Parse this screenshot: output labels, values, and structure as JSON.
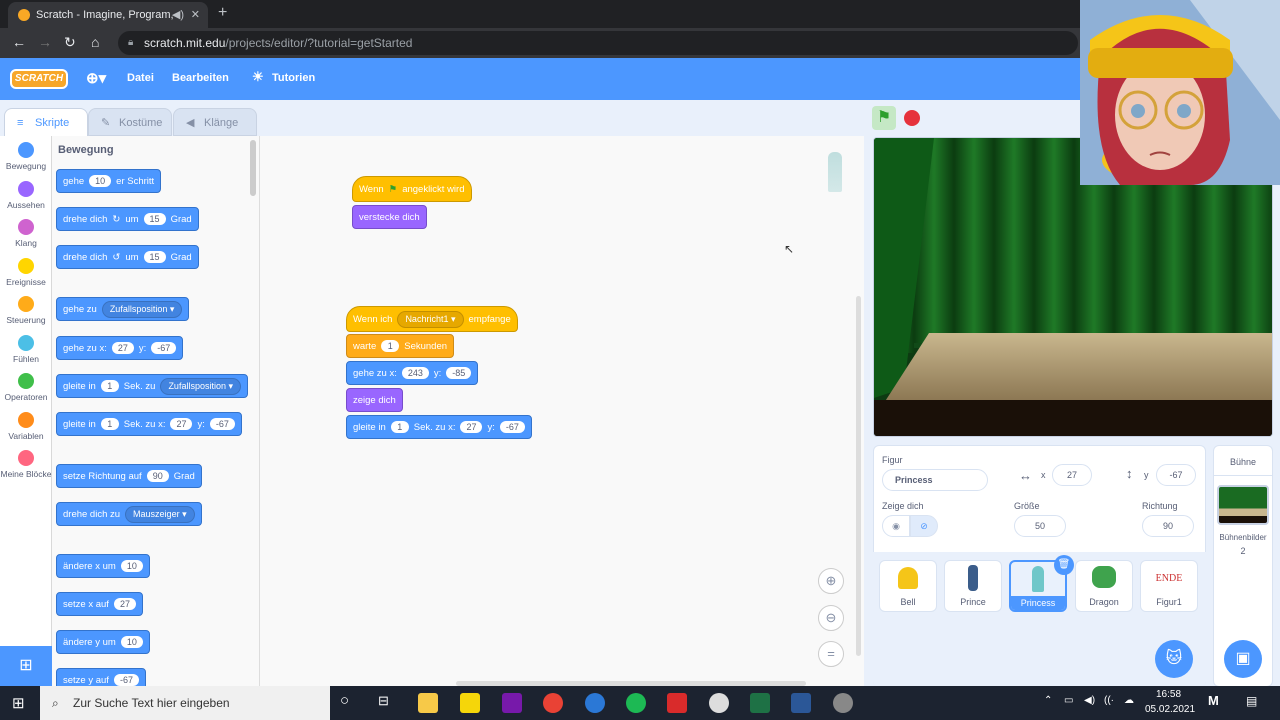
{
  "browser": {
    "tab_title": "Scratch - Imagine, Program,",
    "url_host": "scratch.mit.edu",
    "url_path": "/projects/editor/?tutorial=getStarted"
  },
  "menu": {
    "logo": "SCRATCH",
    "file": "Datei",
    "edit": "Bearbeiten",
    "tutorials": "Tutorien"
  },
  "tabs": {
    "code": "Skripte",
    "costumes": "Kostüme",
    "sounds": "Klänge"
  },
  "categories": [
    {
      "label": "Bewegung",
      "color": "#4c97ff"
    },
    {
      "label": "Aussehen",
      "color": "#9966ff"
    },
    {
      "label": "Klang",
      "color": "#cf63cf"
    },
    {
      "label": "Ereignisse",
      "color": "#ffd500"
    },
    {
      "label": "Steuerung",
      "color": "#ffab19"
    },
    {
      "label": "Fühlen",
      "color": "#4cbfe6"
    },
    {
      "label": "Operatoren",
      "color": "#40bf4a"
    },
    {
      "label": "Variablen",
      "color": "#ff8c1a"
    },
    {
      "label": "Meine Blöcke",
      "color": "#ff6680"
    }
  ],
  "palette": {
    "heading": "Bewegung",
    "b1": {
      "a": "gehe",
      "v": "10",
      "b": "er Schritt"
    },
    "b2": {
      "a": "drehe dich",
      "b": "um",
      "v": "15",
      "c": "Grad"
    },
    "b3": {
      "a": "drehe dich",
      "b": "um",
      "v": "15",
      "c": "Grad"
    },
    "b4": {
      "a": "gehe zu",
      "d": "Zufallsposition"
    },
    "b5": {
      "a": "gehe zu x:",
      "x": "27",
      "b": "y:",
      "y": "-67"
    },
    "b6": {
      "a": "gleite in",
      "v": "1",
      "b": "Sek. zu",
      "d": "Zufallsposition"
    },
    "b7": {
      "a": "gleite in",
      "v": "1",
      "b": "Sek. zu x:",
      "x": "27",
      "c": "y:",
      "y": "-67"
    },
    "b8": {
      "a": "setze Richtung auf",
      "v": "90",
      "b": "Grad"
    },
    "b9": {
      "a": "drehe dich zu",
      "d": "Mauszeiger"
    },
    "b10": {
      "a": "ändere x um",
      "v": "10"
    },
    "b11": {
      "a": "setze x auf",
      "v": "27"
    },
    "b12": {
      "a": "ändere y um",
      "v": "10"
    },
    "b13": {
      "a": "setze y auf",
      "v": "-67"
    }
  },
  "script1": {
    "hat_a": "Wenn",
    "hat_b": "angeklickt wird",
    "hide": "verstecke dich"
  },
  "script2": {
    "hat_a": "Wenn ich",
    "msg": "Nachricht1",
    "hat_b": "empfange",
    "wait_a": "warte",
    "wait_v": "1",
    "wait_b": "Sekunden",
    "goto_a": "gehe zu x:",
    "goto_x": "243",
    "goto_b": "y:",
    "goto_y": "-85",
    "show": "zeige dich",
    "glide_a": "gleite in",
    "glide_v": "1",
    "glide_b": "Sek. zu x:",
    "glide_x": "27",
    "glide_c": "y:",
    "glide_y": "-67"
  },
  "sprite_info": {
    "label_sprite": "Figur",
    "name": "Princess",
    "x_label": "x",
    "x": "27",
    "y_label": "y",
    "y": "-67",
    "show_label": "Zeige dich",
    "size_label": "Größe",
    "size": "50",
    "dir_label": "Richtung",
    "dir": "90"
  },
  "sprites": [
    {
      "name": "Bell"
    },
    {
      "name": "Prince"
    },
    {
      "name": "Princess"
    },
    {
      "name": "Dragon"
    },
    {
      "name": "Figur1",
      "thumb_text": "ENDE"
    }
  ],
  "stage_panel": {
    "title": "Bühne",
    "backdrops_label": "Bühnenbilder",
    "backdrops_count": "2"
  },
  "taskbar": {
    "search_placeholder": "Zur Suche Text hier eingeben",
    "time": "16:58",
    "date": "05.02.2021"
  }
}
